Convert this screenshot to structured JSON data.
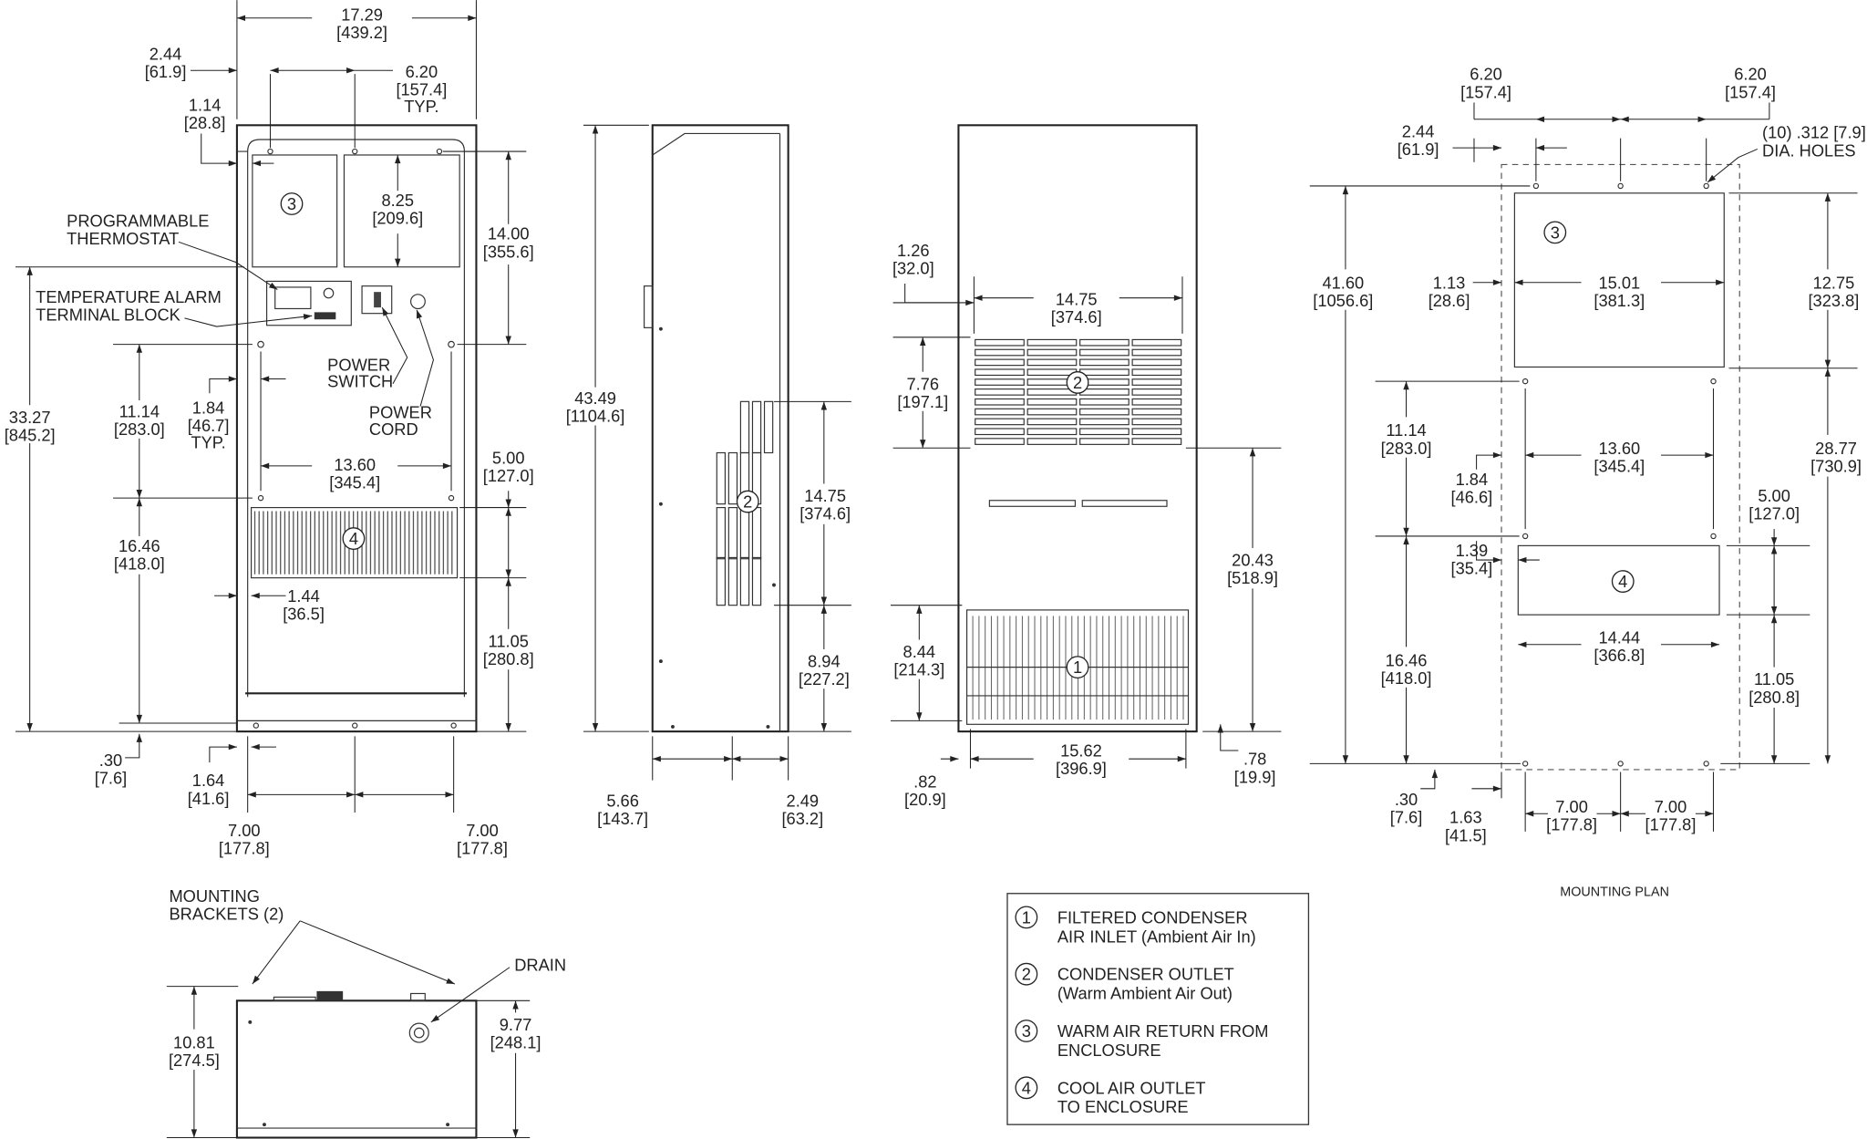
{
  "front_view": {
    "dims": [
      {
        "in": "17.29",
        "mm": "[439.2]"
      },
      {
        "in": "2.44",
        "mm": "[61.9]"
      },
      {
        "in": "6.20",
        "mm": "[157.4]",
        "note": "TYP."
      },
      {
        "in": "1.14",
        "mm": "[28.8]"
      },
      {
        "in": "8.25",
        "mm": "[209.6]"
      },
      {
        "in": "14.00",
        "mm": "[355.6]"
      },
      {
        "in": "33.27",
        "mm": "[845.2]"
      },
      {
        "in": "11.14",
        "mm": "[283.0]"
      },
      {
        "in": "1.84",
        "mm": "[46.7]",
        "note": "TYP."
      },
      {
        "in": "13.60",
        "mm": "[345.4]"
      },
      {
        "in": "5.00",
        "mm": "[127.0]"
      },
      {
        "in": "16.46",
        "mm": "[418.0]"
      },
      {
        "in": "1.44",
        "mm": "[36.5]"
      },
      {
        "in": "11.05",
        "mm": "[280.8]"
      },
      {
        "in": ".30",
        "mm": "[7.6]"
      },
      {
        "in": "1.64",
        "mm": "[41.6]"
      },
      {
        "in": "7.00",
        "mm": "[177.8]"
      },
      {
        "in": "7.00",
        "mm": "[177.8]"
      }
    ],
    "labels": {
      "thermostat": [
        "PROGRAMMABLE",
        "THERMOSTAT"
      ],
      "alarm": [
        "TEMPERATURE ALARM",
        "TERMINAL BLOCK"
      ],
      "switch": [
        "POWER",
        "SWITCH"
      ],
      "cord": [
        "POWER",
        "CORD"
      ]
    },
    "callouts": [
      "3",
      "4"
    ]
  },
  "side_view": {
    "dims": [
      {
        "in": "43.49",
        "mm": "[1104.6]"
      },
      {
        "in": "14.75",
        "mm": "[374.6]"
      },
      {
        "in": "8.94",
        "mm": "[227.2]"
      },
      {
        "in": "5.66",
        "mm": "[143.7]"
      },
      {
        "in": "2.49",
        "mm": "[63.2]"
      }
    ],
    "callouts": [
      "2"
    ]
  },
  "rear_view": {
    "dims": [
      {
        "in": "1.26",
        "mm": "[32.0]"
      },
      {
        "in": "14.75",
        "mm": "[374.6]"
      },
      {
        "in": "7.76",
        "mm": "[197.1]"
      },
      {
        "in": "20.43",
        "mm": "[518.9]"
      },
      {
        "in": "8.44",
        "mm": "[214.3]"
      },
      {
        "in": "15.62",
        "mm": "[396.9]"
      },
      {
        "in": ".82",
        "mm": "[20.9]"
      },
      {
        "in": ".78",
        "mm": "[19.9]"
      }
    ],
    "callouts": [
      "2",
      "1"
    ]
  },
  "mounting_plan": {
    "title": "MOUNTING PLAN",
    "holes_note": [
      "(10) .312 [7.9]",
      "DIA. HOLES"
    ],
    "dims": [
      {
        "in": "6.20",
        "mm": "[157.4]"
      },
      {
        "in": "6.20",
        "mm": "[157.4]"
      },
      {
        "in": "2.44",
        "mm": "[61.9]"
      },
      {
        "in": "41.60",
        "mm": "[1056.6]"
      },
      {
        "in": "1.13",
        "mm": "[28.6]"
      },
      {
        "in": "15.01",
        "mm": "[381.3]"
      },
      {
        "in": "12.75",
        "mm": "[323.8]"
      },
      {
        "in": "11.14",
        "mm": "[283.0]"
      },
      {
        "in": "13.60",
        "mm": "[345.4]"
      },
      {
        "in": "28.77",
        "mm": "[730.9]"
      },
      {
        "in": "1.84",
        "mm": "[46.6]"
      },
      {
        "in": "5.00",
        "mm": "[127.0]"
      },
      {
        "in": "1.39",
        "mm": "[35.4]"
      },
      {
        "in": "14.44",
        "mm": "[366.8]"
      },
      {
        "in": "16.46",
        "mm": "[418.0]"
      },
      {
        "in": "11.05",
        "mm": "[280.8]"
      },
      {
        "in": ".30",
        "mm": "[7.6]"
      },
      {
        "in": "1.63",
        "mm": "[41.5]"
      },
      {
        "in": "7.00",
        "mm": "[177.8]"
      },
      {
        "in": "7.00",
        "mm": "[177.8]"
      }
    ],
    "callouts": [
      "3",
      "4"
    ]
  },
  "bottom_view": {
    "labels": {
      "brackets": [
        "MOUNTING",
        "BRACKETS (2)"
      ],
      "drain": "DRAIN"
    },
    "dims": [
      {
        "in": "10.81",
        "mm": "[274.5]"
      },
      {
        "in": "9.77",
        "mm": "[248.1]"
      }
    ]
  },
  "legend": {
    "items": [
      {
        "num": "1",
        "lines": [
          "FILTERED CONDENSER",
          "AIR INLET (Ambient Air In)"
        ]
      },
      {
        "num": "2",
        "lines": [
          "CONDENSER OUTLET",
          "(Warm Ambient Air Out)"
        ]
      },
      {
        "num": "3",
        "lines": [
          "WARM AIR RETURN FROM",
          "ENCLOSURE"
        ]
      },
      {
        "num": "4",
        "lines": [
          "COOL AIR OUTLET",
          "TO ENCLOSURE"
        ]
      }
    ]
  }
}
